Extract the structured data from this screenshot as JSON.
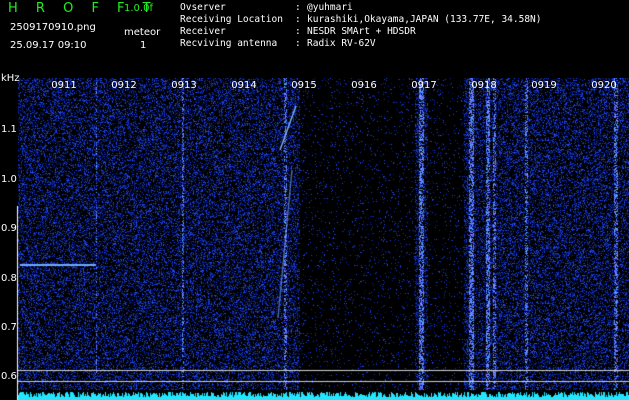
{
  "header": {
    "app_title": "H R O F F T",
    "version": "1.0.0f",
    "filename": "2509170910.png",
    "timestamp": "25.09.17 09:10",
    "meteor_label": "meteor",
    "meteor_count": "1"
  },
  "info": [
    {
      "key": "Ovserver",
      "sep": ":",
      "value": "@yuhmari"
    },
    {
      "key": "Receiving Location",
      "sep": ":",
      "value": "kurashiki,Okayama,JAPAN (133.77E, 34.58N)"
    },
    {
      "key": "Receiver",
      "sep": ":",
      "value": "NESDR SMArt + HDSDR"
    },
    {
      "key": "Recviving antenna",
      "sep": ":",
      "value": "Radix RV-62V"
    }
  ],
  "axis": {
    "unit": "kHz",
    "y_ticks": [
      "1.1",
      "1.0",
      "0.9",
      "0.8",
      "0.7",
      "0.6"
    ],
    "time_ticks": [
      "0911",
      "0912",
      "0913",
      "0914",
      "0915",
      "0916",
      "0917",
      "0918",
      "0919",
      "0920"
    ]
  },
  "colors": {
    "title_green": "#22ee22",
    "noise_blue": "#1a3cff",
    "baseline_cyan": "#22e6ff"
  }
}
